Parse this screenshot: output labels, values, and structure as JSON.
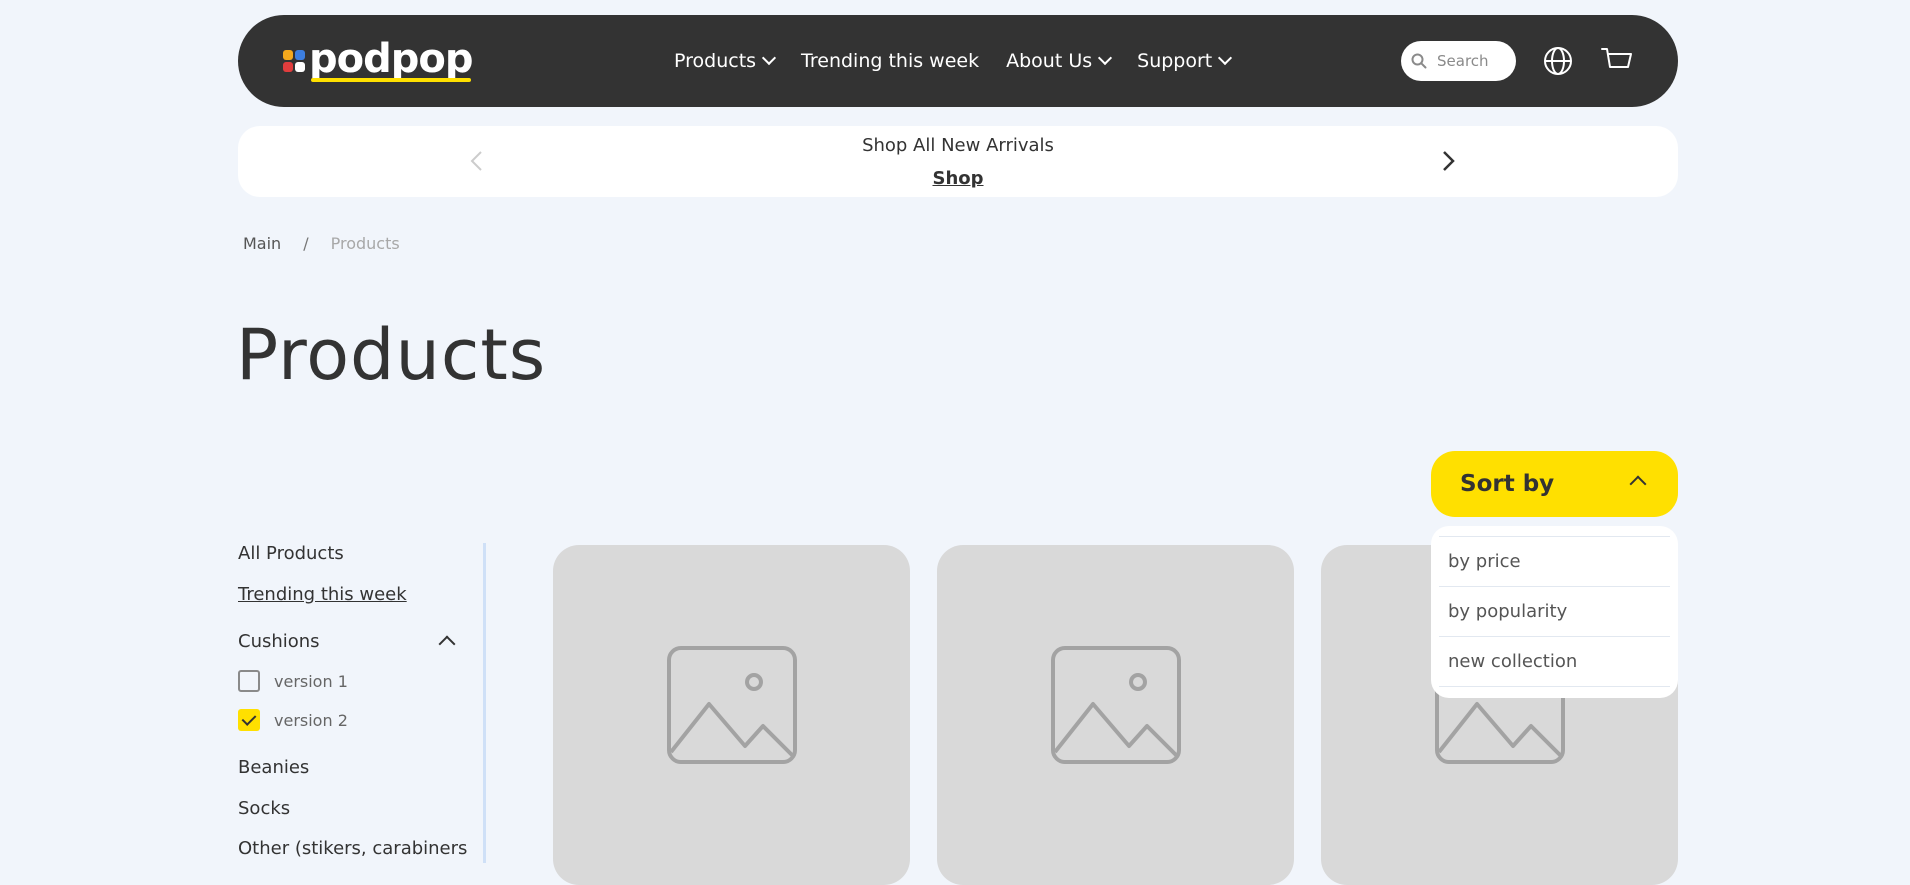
{
  "header": {
    "logo_text": "podpop",
    "logo_colors": [
      "#f4a91d",
      "#3d7fe0",
      "#e03d3d",
      "#ffffff"
    ],
    "nav": [
      {
        "label": "Products",
        "has_dropdown": true
      },
      {
        "label": "Trending this week",
        "has_dropdown": false
      },
      {
        "label": "About Us",
        "has_dropdown": true
      },
      {
        "label": "Support",
        "has_dropdown": true
      }
    ],
    "search_placeholder": "Search",
    "icons": [
      "search-icon",
      "globe-icon",
      "cart-icon"
    ]
  },
  "banner": {
    "title": "Shop All New Arrivals",
    "link": "Shop"
  },
  "breadcrumb": {
    "main": "Main",
    "separator": "/",
    "current": "Products"
  },
  "page_title": "Products",
  "sort": {
    "label": "Sort by",
    "options": [
      "by price",
      "by popularity",
      "new collection"
    ]
  },
  "sidebar": {
    "all": "All Products",
    "trending": "Trending this week",
    "cushions": "Cushions",
    "cushion_versions": [
      {
        "label": "version 1",
        "checked": false
      },
      {
        "label": "version 2",
        "checked": true
      }
    ],
    "beanies": "Beanies",
    "socks": "Socks",
    "other": "Other (stikers, carabiners"
  },
  "colors": {
    "header_bg": "#333333",
    "accent": "#ffe000",
    "page_bg": "#f1f5fb",
    "placeholder_bg": "#d9d9d9"
  },
  "cards": [
    {
      "image": "image-placeholder-icon"
    },
    {
      "image": "image-placeholder-icon"
    },
    {
      "image": "image-placeholder-icon"
    }
  ]
}
